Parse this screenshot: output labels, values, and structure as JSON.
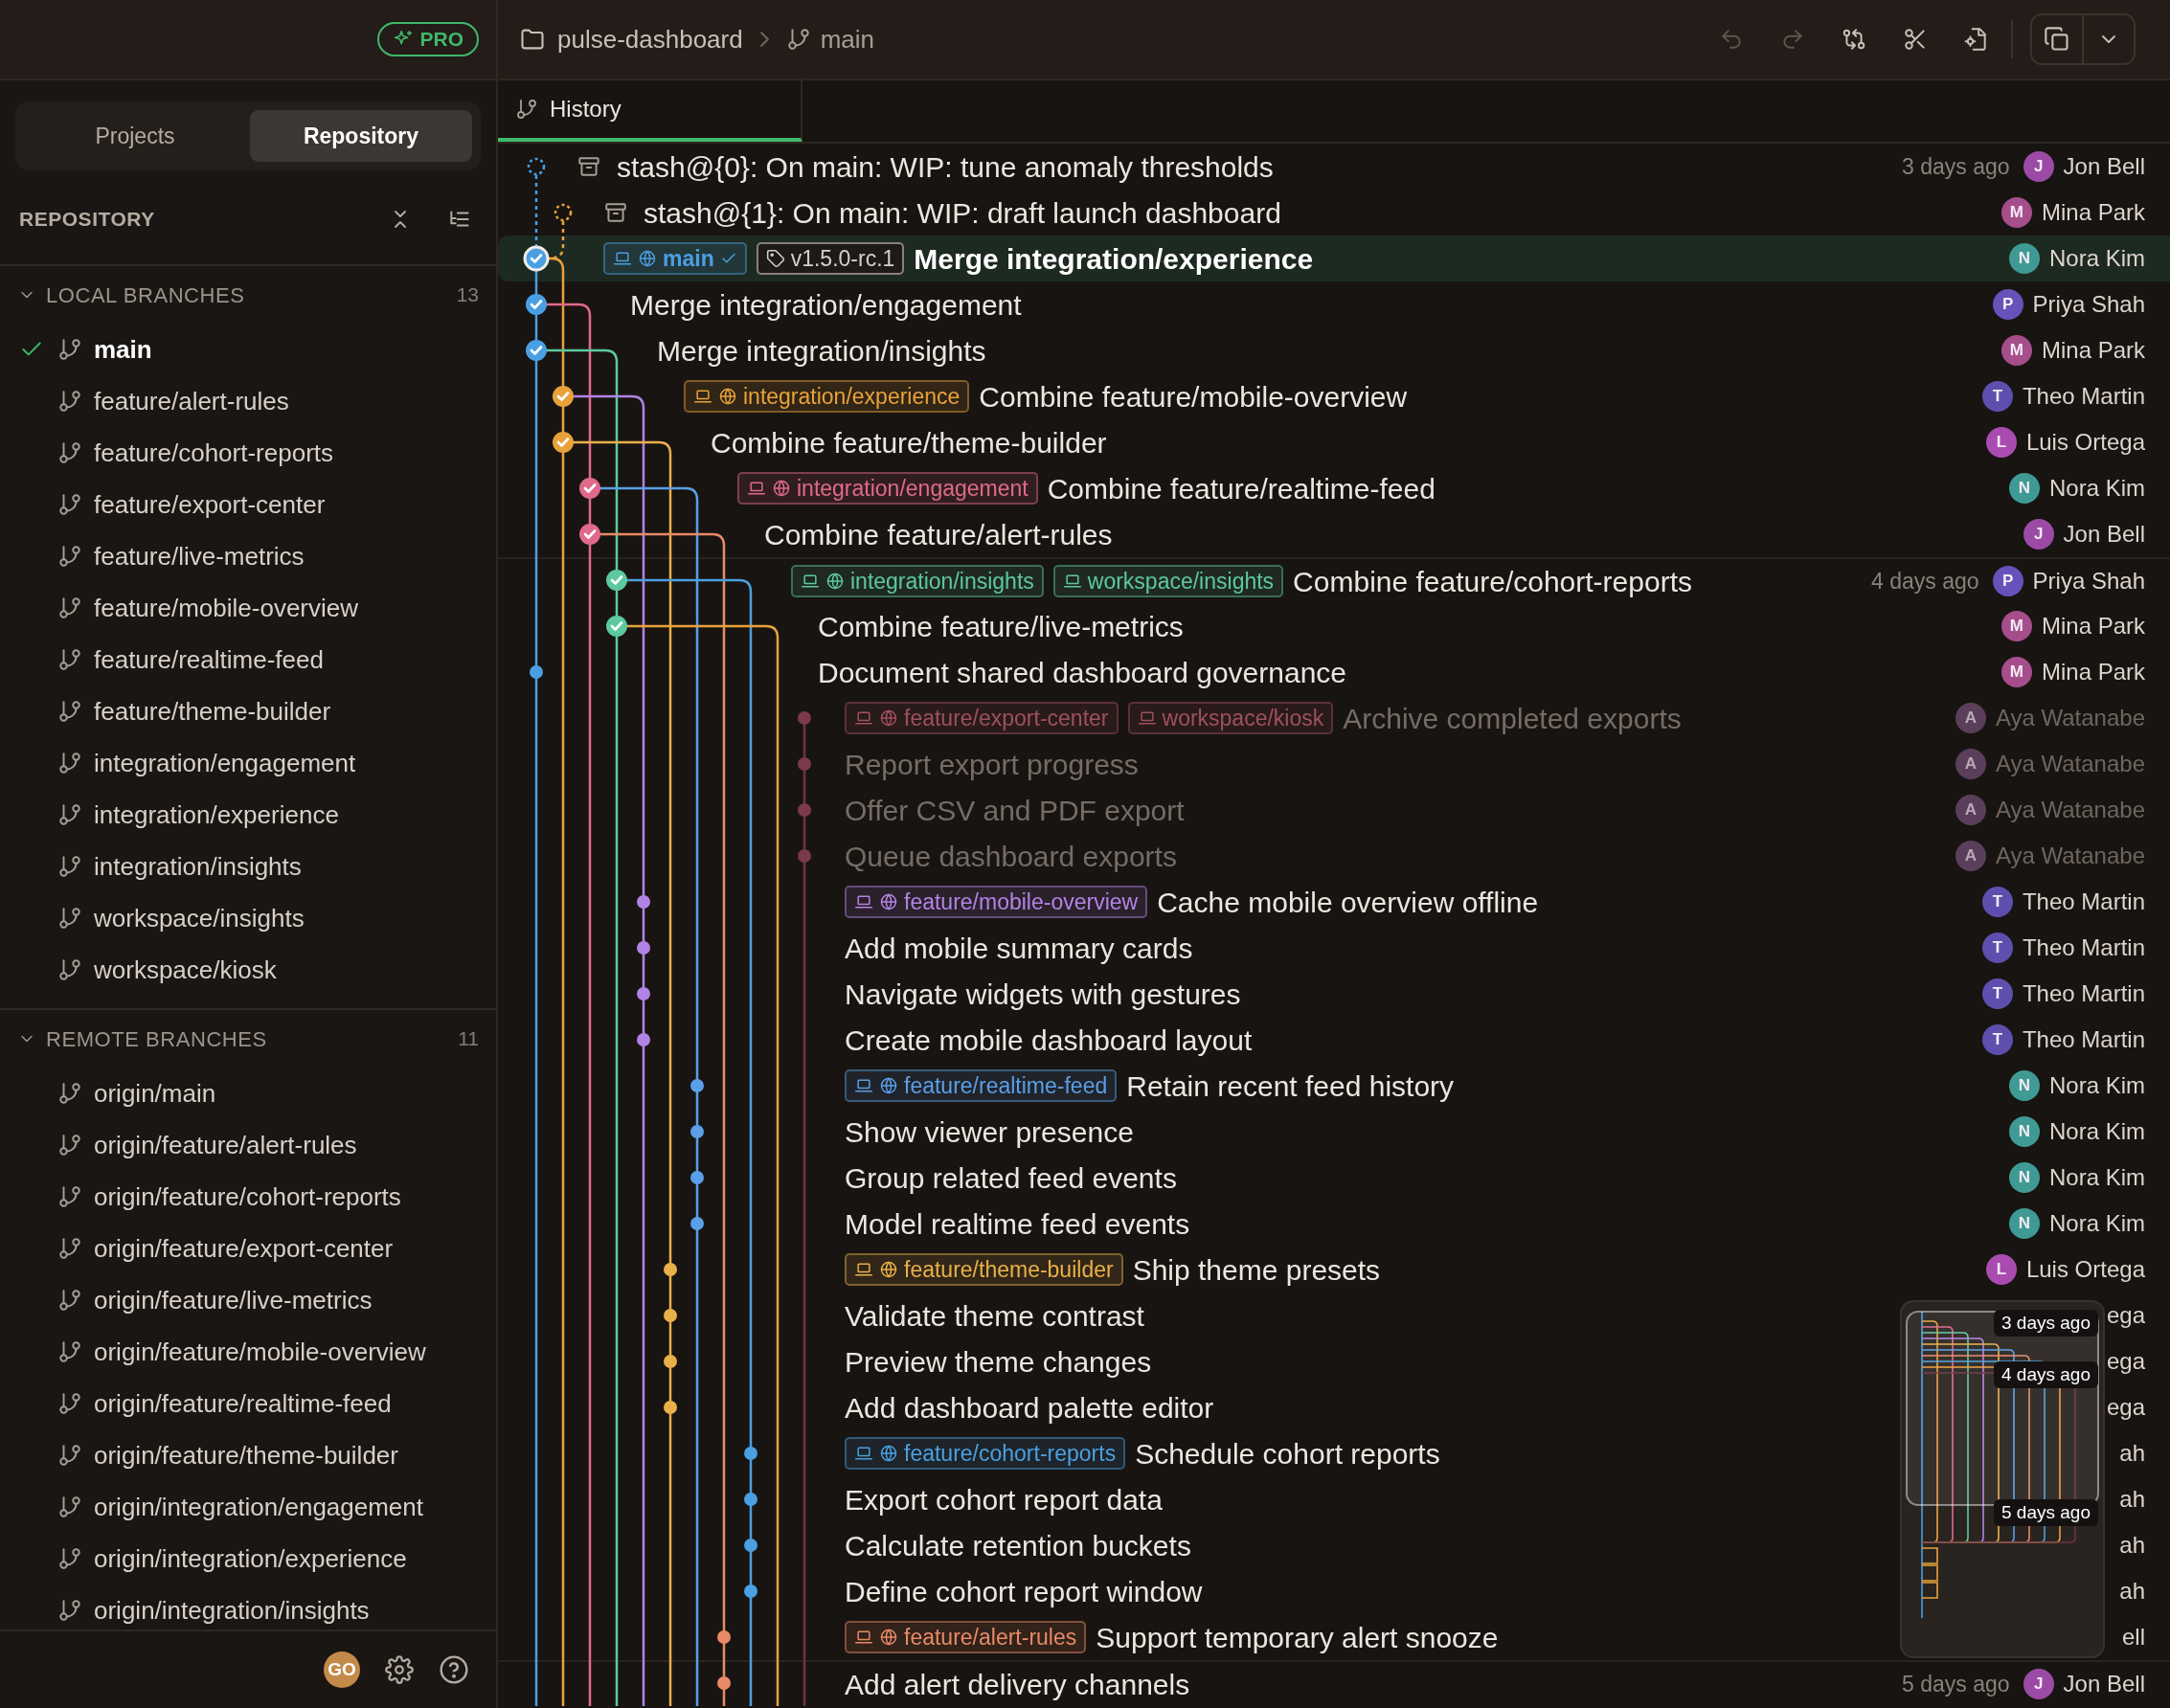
{
  "sidebar": {
    "pro_badge": "PRO",
    "tabs": [
      {
        "label": "Projects",
        "selected": false
      },
      {
        "label": "Repository",
        "selected": true
      }
    ],
    "section_title": "REPOSITORY",
    "groups": [
      {
        "title": "LOCAL BRANCHES",
        "count": "13",
        "expanded": true,
        "items": [
          {
            "label": "main",
            "current": true
          },
          {
            "label": "feature/alert-rules",
            "current": false
          },
          {
            "label": "feature/cohort-reports",
            "current": false
          },
          {
            "label": "feature/export-center",
            "current": false
          },
          {
            "label": "feature/live-metrics",
            "current": false
          },
          {
            "label": "feature/mobile-overview",
            "current": false
          },
          {
            "label": "feature/realtime-feed",
            "current": false
          },
          {
            "label": "feature/theme-builder",
            "current": false
          },
          {
            "label": "integration/engagement",
            "current": false
          },
          {
            "label": "integration/experience",
            "current": false
          },
          {
            "label": "integration/insights",
            "current": false
          },
          {
            "label": "workspace/insights",
            "current": false
          },
          {
            "label": "workspace/kiosk",
            "current": false
          }
        ]
      },
      {
        "title": "REMOTE BRANCHES",
        "count": "11",
        "expanded": true,
        "items": [
          {
            "label": "origin/main",
            "current": false
          },
          {
            "label": "origin/feature/alert-rules",
            "current": false
          },
          {
            "label": "origin/feature/cohort-reports",
            "current": false
          },
          {
            "label": "origin/feature/export-center",
            "current": false
          },
          {
            "label": "origin/feature/live-metrics",
            "current": false
          },
          {
            "label": "origin/feature/mobile-overview",
            "current": false
          },
          {
            "label": "origin/feature/realtime-feed",
            "current": false
          },
          {
            "label": "origin/feature/theme-builder",
            "current": false
          },
          {
            "label": "origin/integration/engagement",
            "current": false
          },
          {
            "label": "origin/integration/experience",
            "current": false
          },
          {
            "label": "origin/integration/insights",
            "current": false
          }
        ]
      }
    ],
    "footer": {
      "avatar": "GO"
    }
  },
  "header": {
    "repo": "pulse-dashboard",
    "branch": "main",
    "toolbar": [
      {
        "kind": "undo",
        "disabled": true
      },
      {
        "kind": "redo",
        "disabled": true
      },
      {
        "kind": "compare",
        "disabled": false
      },
      {
        "kind": "cut",
        "disabled": false
      },
      {
        "kind": "file-settings",
        "disabled": false
      }
    ]
  },
  "tabs": [
    {
      "label": "History",
      "selected": true
    }
  ],
  "commits": [
    {
      "kind": "stash",
      "message": "stash@{0}: On main: WIP: tune anomaly thresholds",
      "color": "#4a9fe3",
      "date": "3 days ago",
      "author": "Jon Bell",
      "avatar": {
        "initial": "J",
        "color": "#9b4aa6"
      },
      "selected": false,
      "dimmed": false
    },
    {
      "kind": "stash",
      "message": "stash@{1}: On main: WIP: draft launch dashboard",
      "color": "#e9a23b",
      "author": "Mina Park",
      "avatar": {
        "initial": "M",
        "color": "#a64d8c"
      },
      "selected": false,
      "dimmed": false
    },
    {
      "kind": "merge",
      "message": "Merge integration/experience",
      "color": "#4a9fe3",
      "refs": [
        {
          "kind": "branch",
          "label": "main",
          "local": true,
          "remote": true,
          "current": true,
          "color": "#4a9fe3"
        },
        {
          "kind": "tag",
          "label": "v1.5.0-rc.1",
          "local": false,
          "remote": false,
          "current": false,
          "color": "#d8d0c8"
        }
      ],
      "author": "Nora Kim",
      "avatar": {
        "initial": "N",
        "color": "#3f9a94"
      },
      "selected": true,
      "dimmed": false
    },
    {
      "kind": "merge",
      "message": "Merge integration/engagement",
      "color": "#4a9fe3",
      "author": "Priya Shah",
      "avatar": {
        "initial": "P",
        "color": "#6652b8"
      },
      "selected": false,
      "dimmed": false
    },
    {
      "kind": "merge",
      "message": "Merge integration/insights",
      "color": "#4a9fe3",
      "author": "Mina Park",
      "avatar": {
        "initial": "M",
        "color": "#a64d8c"
      },
      "selected": false,
      "dimmed": false
    },
    {
      "kind": "merge",
      "message": "Combine feature/mobile-overview",
      "color": "#e9a23b",
      "refs": [
        {
          "kind": "branch",
          "label": "integration/experience",
          "local": true,
          "remote": true,
          "current": false,
          "color": "#e9a23b"
        }
      ],
      "author": "Theo Martin",
      "avatar": {
        "initial": "T",
        "color": "#5e4fae"
      },
      "selected": false,
      "dimmed": false
    },
    {
      "kind": "merge",
      "message": "Combine feature/theme-builder",
      "color": "#e9a23b",
      "author": "Luis Ortega",
      "avatar": {
        "initial": "L",
        "color": "#a94cb0"
      },
      "selected": false,
      "dimmed": false
    },
    {
      "kind": "merge",
      "message": "Combine feature/realtime-feed",
      "color": "#e06a8a",
      "refs": [
        {
          "kind": "branch",
          "label": "integration/engagement",
          "local": true,
          "remote": true,
          "current": false,
          "color": "#e06a8a"
        }
      ],
      "author": "Nora Kim",
      "avatar": {
        "initial": "N",
        "color": "#3f9a94"
      },
      "selected": false,
      "dimmed": false
    },
    {
      "kind": "merge",
      "message": "Combine feature/alert-rules",
      "color": "#e06a8a",
      "author": "Jon Bell",
      "avatar": {
        "initial": "J",
        "color": "#9b4aa6"
      },
      "selected": false,
      "dimmed": false
    },
    {
      "kind": "merge",
      "message": "Combine feature/cohort-reports",
      "color": "#5cc9a0",
      "refs": [
        {
          "kind": "branch",
          "label": "integration/insights",
          "local": true,
          "remote": true,
          "current": false,
          "color": "#5cc9a0"
        },
        {
          "kind": "branch",
          "label": "workspace/insights",
          "local": true,
          "remote": false,
          "current": false,
          "color": "#5cc9a0"
        }
      ],
      "date": "4 days ago",
      "author": "Priya Shah",
      "avatar": {
        "initial": "P",
        "color": "#6652b8"
      },
      "selected": false,
      "dimmed": false
    },
    {
      "kind": "merge",
      "message": "Combine feature/live-metrics",
      "color": "#5cc9a0",
      "author": "Mina Park",
      "avatar": {
        "initial": "M",
        "color": "#a64d8c"
      },
      "selected": false,
      "dimmed": false
    },
    {
      "kind": "commit",
      "message": "Document shared dashboard governance",
      "color": "#4a9fe3",
      "author": "Mina Park",
      "avatar": {
        "initial": "M",
        "color": "#a64d8c"
      },
      "selected": false,
      "dimmed": false
    },
    {
      "kind": "commit",
      "message": "Archive completed exports",
      "color": "#7a3a4a",
      "refs": [
        {
          "kind": "branch",
          "label": "feature/export-center",
          "local": true,
          "remote": true,
          "current": false,
          "color": "#a0505f"
        },
        {
          "kind": "branch",
          "label": "workspace/kiosk",
          "local": true,
          "remote": false,
          "current": false,
          "color": "#a0505f"
        }
      ],
      "author": "Aya Watanabe",
      "avatar": {
        "initial": "A",
        "color": "#5a3f5a"
      },
      "selected": false,
      "dimmed": true
    },
    {
      "kind": "commit",
      "message": "Report export progress",
      "color": "#7a3a4a",
      "author": "Aya Watanabe",
      "avatar": {
        "initial": "A",
        "color": "#5a3f5a"
      },
      "selected": false,
      "dimmed": true
    },
    {
      "kind": "commit",
      "message": "Offer CSV and PDF export",
      "color": "#7a3a4a",
      "author": "Aya Watanabe",
      "avatar": {
        "initial": "A",
        "color": "#5a3f5a"
      },
      "selected": false,
      "dimmed": true
    },
    {
      "kind": "commit",
      "message": "Queue dashboard exports",
      "color": "#7a3a4a",
      "author": "Aya Watanabe",
      "avatar": {
        "initial": "A",
        "color": "#5a3f5a"
      },
      "selected": false,
      "dimmed": true
    },
    {
      "kind": "commit",
      "message": "Cache mobile overview offline",
      "color": "#b283e6",
      "refs": [
        {
          "kind": "branch",
          "label": "feature/mobile-overview",
          "local": true,
          "remote": true,
          "current": false,
          "color": "#b283e6"
        }
      ],
      "author": "Theo Martin",
      "avatar": {
        "initial": "T",
        "color": "#5e4fae"
      },
      "selected": false,
      "dimmed": false
    },
    {
      "kind": "commit",
      "message": "Add mobile summary cards",
      "color": "#b283e6",
      "author": "Theo Martin",
      "avatar": {
        "initial": "T",
        "color": "#5e4fae"
      },
      "selected": false,
      "dimmed": false
    },
    {
      "kind": "commit",
      "message": "Navigate widgets with gestures",
      "color": "#b283e6",
      "author": "Theo Martin",
      "avatar": {
        "initial": "T",
        "color": "#5e4fae"
      },
      "selected": false,
      "dimmed": false
    },
    {
      "kind": "commit",
      "message": "Create mobile dashboard layout",
      "color": "#b283e6",
      "author": "Theo Martin",
      "avatar": {
        "initial": "T",
        "color": "#5e4fae"
      },
      "selected": false,
      "dimmed": false
    },
    {
      "kind": "commit",
      "message": "Retain recent feed history",
      "color": "#5a9fe8",
      "refs": [
        {
          "kind": "branch",
          "label": "feature/realtime-feed",
          "local": true,
          "remote": true,
          "current": false,
          "color": "#5a9fe8"
        }
      ],
      "author": "Nora Kim",
      "avatar": {
        "initial": "N",
        "color": "#3f9a94"
      },
      "selected": false,
      "dimmed": false
    },
    {
      "kind": "commit",
      "message": "Show viewer presence",
      "color": "#5a9fe8",
      "author": "Nora Kim",
      "avatar": {
        "initial": "N",
        "color": "#3f9a94"
      },
      "selected": false,
      "dimmed": false
    },
    {
      "kind": "commit",
      "message": "Group related feed events",
      "color": "#5a9fe8",
      "author": "Nora Kim",
      "avatar": {
        "initial": "N",
        "color": "#3f9a94"
      },
      "selected": false,
      "dimmed": false
    },
    {
      "kind": "commit",
      "message": "Model realtime feed events",
      "color": "#5a9fe8",
      "author": "Nora Kim",
      "avatar": {
        "initial": "N",
        "color": "#3f9a94"
      },
      "selected": false,
      "dimmed": false
    },
    {
      "kind": "commit",
      "message": "Ship theme presets",
      "color": "#e9b04a",
      "refs": [
        {
          "kind": "branch",
          "label": "feature/theme-builder",
          "local": true,
          "remote": true,
          "current": false,
          "color": "#e9b04a"
        }
      ],
      "author": "Luis Ortega",
      "avatar": {
        "initial": "L",
        "color": "#a94cb0"
      },
      "selected": false,
      "dimmed": false
    },
    {
      "kind": "commit",
      "message": "Validate theme contrast",
      "color": "#e9b04a",
      "author": "ega",
      "selected": false,
      "dimmed": false
    },
    {
      "kind": "commit",
      "message": "Preview theme changes",
      "color": "#e9b04a",
      "author": "ega",
      "selected": false,
      "dimmed": false
    },
    {
      "kind": "commit",
      "message": "Add dashboard palette editor",
      "color": "#e9b04a",
      "author": "ega",
      "selected": false,
      "dimmed": false
    },
    {
      "kind": "commit",
      "message": "Schedule cohort reports",
      "color": "#4aa0e0",
      "refs": [
        {
          "kind": "branch",
          "label": "feature/cohort-reports",
          "local": true,
          "remote": true,
          "current": false,
          "color": "#4aa0e0"
        }
      ],
      "author": "ah",
      "selected": false,
      "dimmed": false
    },
    {
      "kind": "commit",
      "message": "Export cohort report data",
      "color": "#4aa0e0",
      "author": "ah",
      "selected": false,
      "dimmed": false
    },
    {
      "kind": "commit",
      "message": "Calculate retention buckets",
      "color": "#4aa0e0",
      "author": "ah",
      "selected": false,
      "dimmed": false
    },
    {
      "kind": "commit",
      "message": "Define cohort report window",
      "color": "#4aa0e0",
      "author": "ah",
      "selected": false,
      "dimmed": false
    },
    {
      "kind": "commit",
      "message": "Support temporary alert snooze",
      "color": "#e88a66",
      "refs": [
        {
          "kind": "branch",
          "label": "feature/alert-rules",
          "local": true,
          "remote": true,
          "current": false,
          "color": "#e88a66"
        }
      ],
      "author": "ell",
      "selected": false,
      "dimmed": false
    },
    {
      "kind": "commit",
      "message": "Add alert delivery channels",
      "color": "#e88a66",
      "date": "5 days ago",
      "author": "Jon Bell",
      "avatar": {
        "initial": "J",
        "color": "#9b4aa6"
      },
      "selected": false,
      "dimmed": false
    }
  ],
  "minimap": {
    "labels": [
      "3 days ago",
      "4 days ago",
      "5 days ago"
    ]
  }
}
